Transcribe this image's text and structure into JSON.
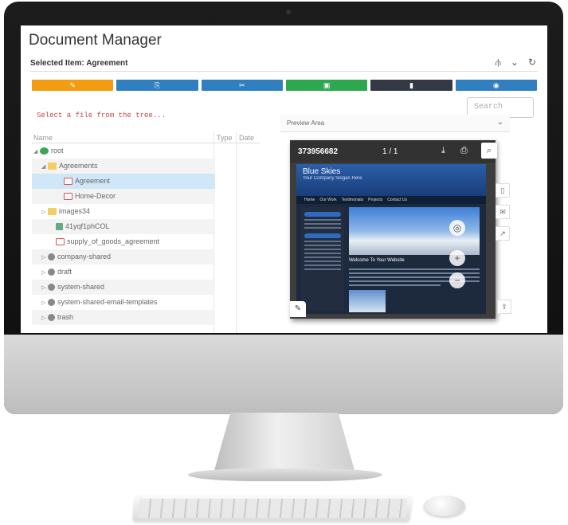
{
  "app": {
    "title": "Document Manager"
  },
  "selected": {
    "label": "Selected Item: Agreement"
  },
  "header_icons": [
    "sitemap-icon",
    "chevron-down-icon",
    "refresh-icon"
  ],
  "toolbar": [
    {
      "name": "edit-button",
      "icon": "edit-icon",
      "glyph": "✎",
      "color": "#f39c12"
    },
    {
      "name": "copy-button",
      "icon": "copy-icon",
      "glyph": "⎘",
      "color": "#2f7fc1"
    },
    {
      "name": "cut-button",
      "icon": "scissors-icon",
      "glyph": "✂",
      "color": "#2f7fc1"
    },
    {
      "name": "paste-button",
      "icon": "paste-icon",
      "glyph": "▣",
      "color": "#2ea84f"
    },
    {
      "name": "delete-button",
      "icon": "trash-icon",
      "glyph": "▮",
      "color": "#333a45"
    },
    {
      "name": "view-button",
      "icon": "eye-icon",
      "glyph": "◉",
      "color": "#2f7fc1"
    }
  ],
  "search": {
    "placeholder": "Search"
  },
  "hint": "Select a file from the tree...",
  "tree": {
    "columns": {
      "name": "Name",
      "type": "Type",
      "date": "Date"
    },
    "rows": [
      {
        "label": "root",
        "indent": 0,
        "caret": "◢",
        "icon": "globe"
      },
      {
        "label": "Agreements",
        "indent": 1,
        "caret": "◢",
        "icon": "folder"
      },
      {
        "label": "Agreement",
        "indent": 3,
        "caret": "",
        "icon": "pdf",
        "selected": true
      },
      {
        "label": "Home-Decor",
        "indent": 3,
        "caret": "",
        "icon": "pdf"
      },
      {
        "label": "images34",
        "indent": 1,
        "caret": "▷",
        "icon": "folder"
      },
      {
        "label": "41yqf1phCOL",
        "indent": 2,
        "caret": "",
        "icon": "doc"
      },
      {
        "label": "supply_of_goods_agreement",
        "indent": 2,
        "caret": "",
        "icon": "pdf"
      },
      {
        "label": "company-shared",
        "indent": 1,
        "caret": "▷",
        "icon": "gear"
      },
      {
        "label": "draft",
        "indent": 1,
        "caret": "▷",
        "icon": "gear"
      },
      {
        "label": "system-shared",
        "indent": 1,
        "caret": "▷",
        "icon": "gear"
      },
      {
        "label": "system-shared-email-templates",
        "indent": 1,
        "caret": "▷",
        "icon": "gear"
      },
      {
        "label": "trash",
        "indent": 1,
        "caret": "▷",
        "icon": "gear"
      }
    ]
  },
  "preview": {
    "label": "Preview Area",
    "doc_id": "373956682",
    "page": "1 / 1",
    "site": {
      "name": "Blue Skies",
      "tagline": "Your Company Slogan Here",
      "nav": [
        "Home",
        "Our Work",
        "Testimonials",
        "Projects",
        "Contact Us"
      ],
      "welcome": "Welcome To Your Website"
    }
  }
}
